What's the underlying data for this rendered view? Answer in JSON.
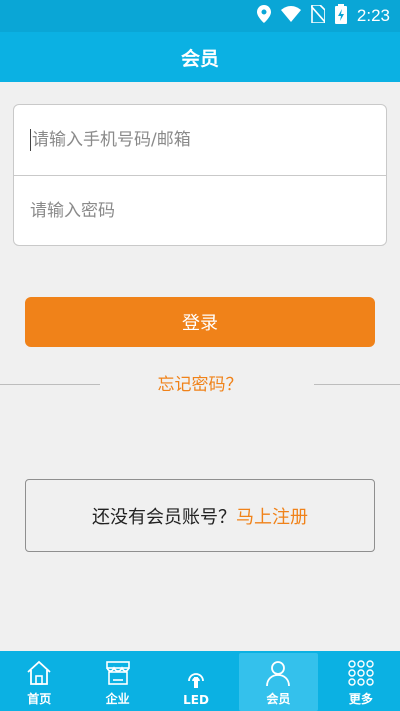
{
  "status_bar": {
    "time": "2:23"
  },
  "header": {
    "title": "会员"
  },
  "login": {
    "phone_placeholder": "请输入手机号码/邮箱",
    "password_placeholder": "请输入密码",
    "login_label": "登录",
    "forgot_label": "忘记密码？"
  },
  "register": {
    "prompt": "还没有会员账号？",
    "link": "马上注册"
  },
  "tabs": [
    {
      "label": "首页",
      "icon": "home-icon"
    },
    {
      "label": "企业",
      "icon": "store-icon"
    },
    {
      "label": "LED",
      "icon": "led-icon"
    },
    {
      "label": "会员",
      "icon": "user-icon",
      "active": true
    },
    {
      "label": "更多",
      "icon": "grid-icon"
    }
  ],
  "colors": {
    "primary": "#0bb1e3",
    "accent": "#f08219"
  }
}
